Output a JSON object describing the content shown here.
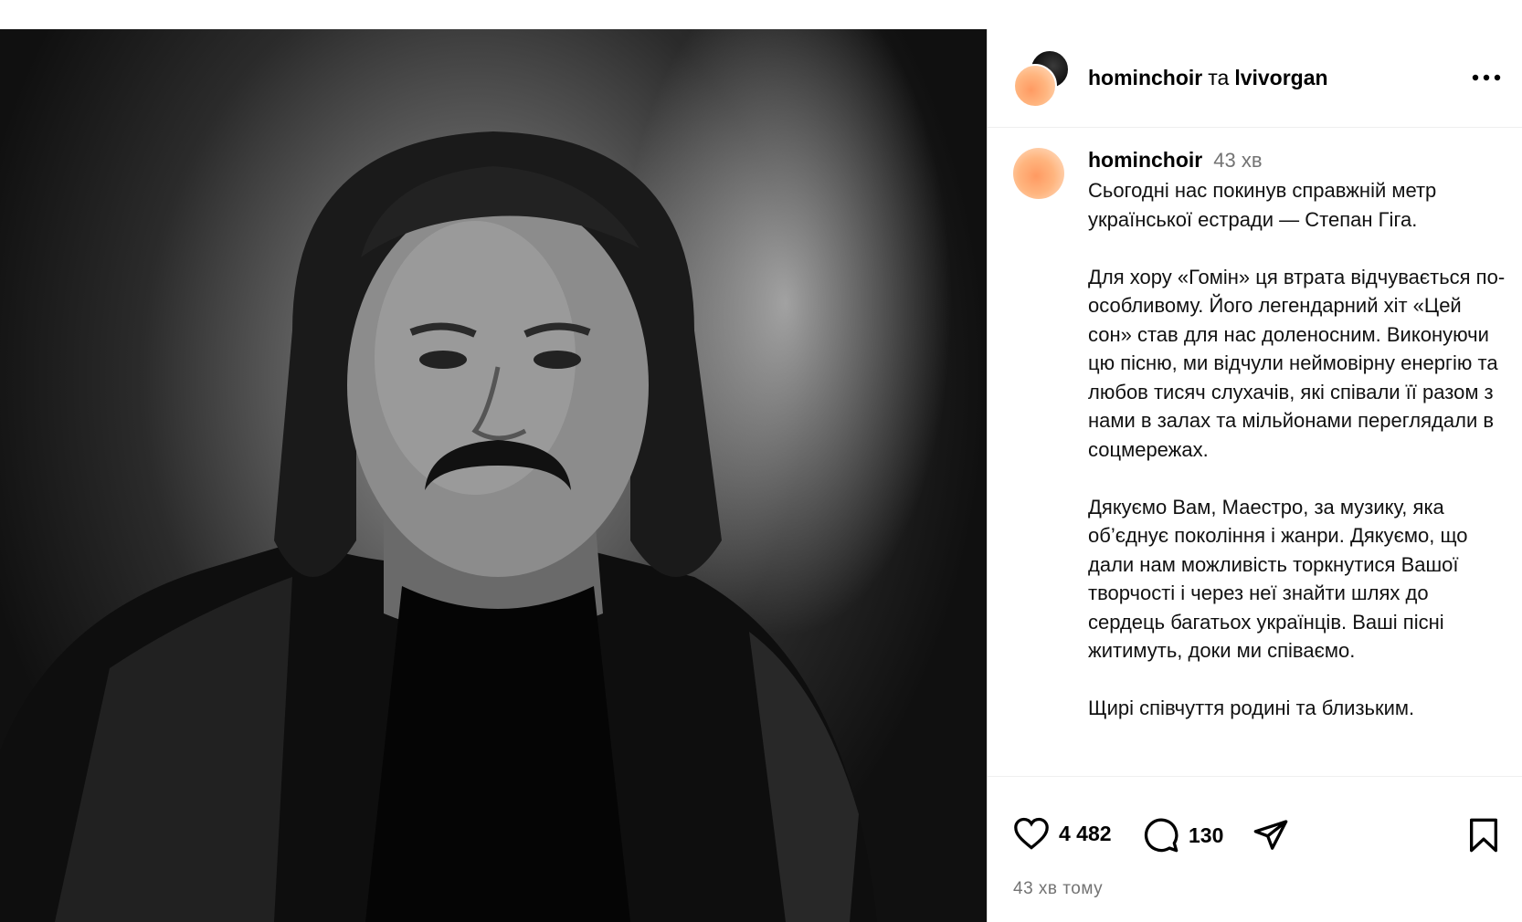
{
  "post": {
    "owners": {
      "primary": "hominchoir",
      "conjunction": "та",
      "secondary": "lvivorgan"
    },
    "comment": {
      "username": "hominchoir",
      "time": "43 хв",
      "caption": "Сьогодні нас покинув справжній метр української естради — Степан Гіга.\n\nДля хору «Гомін» ця втрата відчувається по-особливому. Його легендарний хіт «Цей сон» став для нас доленосним. Виконуючи цю пісню, ми відчули неймовірну енергію та любов тисяч слухачів, які співали її разом з нами в залах та мільйонами переглядали в соцмережах.\n\nДякуємо Вам, Маестро, за музику, яка об’єднує покоління і жанри. Дякуємо, що дали нам можливість торкнутися Вашої творчості і через неї знайти шлях до сердець багатьох українців. Ваші пісні житимуть, доки ми співаємо.\n\nЩирі співчуття родині та близьким."
    },
    "likes": "4 482",
    "comments_count": "130",
    "timestamp": "43 хв тому"
  },
  "icons": {
    "like": "heart-icon",
    "comment": "comment-icon",
    "share": "send-icon",
    "save": "bookmark-icon",
    "more": "more-horizontal-icon"
  },
  "colors": {
    "accent_orange": "#ff9a62",
    "muted_text": "#737373"
  }
}
